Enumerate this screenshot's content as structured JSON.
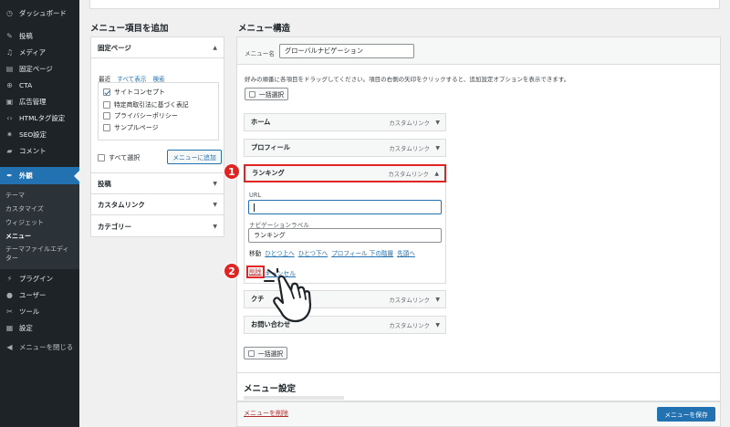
{
  "sidebar": {
    "items": [
      {
        "label": "ダッシュボード",
        "icon": "dashboard-icon"
      },
      {
        "label": "投稿",
        "icon": "pin-icon"
      },
      {
        "label": "メディア",
        "icon": "media-icon"
      },
      {
        "label": "固定ページ",
        "icon": "page-icon"
      },
      {
        "label": "CTA",
        "icon": "cta-icon"
      },
      {
        "label": "広告管理",
        "icon": "ad-icon"
      },
      {
        "label": "HTMLタグ設定",
        "icon": "code-icon"
      },
      {
        "label": "SEO設定",
        "icon": "gear-icon"
      },
      {
        "label": "コメント",
        "icon": "comment-icon"
      },
      {
        "label": "外観",
        "icon": "brush-icon"
      },
      {
        "label": "プラグイン",
        "icon": "plugin-icon"
      },
      {
        "label": "ユーザー",
        "icon": "user-icon"
      },
      {
        "label": "ツール",
        "icon": "wrench-icon"
      },
      {
        "label": "設定",
        "icon": "settings-icon"
      },
      {
        "label": "メニューを閉じる",
        "icon": "collapse-icon"
      }
    ],
    "submenu": [
      "テーマ",
      "カスタマイズ",
      "ウィジェット",
      "メニュー",
      "テーマファイルエディター"
    ]
  },
  "add_items": {
    "title": "メニュー項目を追加",
    "pages_header": "固定ページ",
    "tabs": [
      "最近",
      "すべて表示",
      "検索"
    ],
    "pages": [
      {
        "label": "サイトコンセプト",
        "checked": true
      },
      {
        "label": "特定商取引法に基づく表記",
        "checked": false
      },
      {
        "label": "プライバシーポリシー",
        "checked": false
      },
      {
        "label": "サンプルページ",
        "checked": false
      }
    ],
    "select_all": "すべて選択",
    "add_button": "メニューに追加",
    "sections": [
      "投稿",
      "カスタムリンク",
      "カテゴリー"
    ]
  },
  "structure": {
    "title": "メニュー構造",
    "menu_name_label": "メニュー名",
    "menu_name_value": "グローバルナビゲーション",
    "instructions": "好みの順番に各項目をドラッグしてください。項目の右側の矢印をクリックすると、追加設定オプションを表示できます。",
    "bulk_select": "一括選択",
    "custom_link": "カスタムリンク",
    "items": [
      "ホーム",
      "プロフィール",
      "ランキング",
      "ク",
      "お問い合わせ"
    ],
    "item_ranking_suffix": "チ",
    "url_label": "URL",
    "url_value": "",
    "nav_label": "ナビゲーションラベル",
    "nav_value": "ランキング",
    "move_label": "移動",
    "move_links": [
      "ひとつ上へ",
      "ひとつ下へ",
      "プロフィール 下の階層",
      "先頭へ"
    ],
    "delete": "削除",
    "cancel": "キャンセル",
    "settings_title": "メニュー設定",
    "delete_menu": "メニューを削除",
    "save": "メニューを保存"
  },
  "annotations": {
    "badge1": "1",
    "badge2": "2"
  },
  "colors": {
    "accent": "#2271b1",
    "highlight": "#e02424",
    "sidebar": "#1d2327"
  }
}
